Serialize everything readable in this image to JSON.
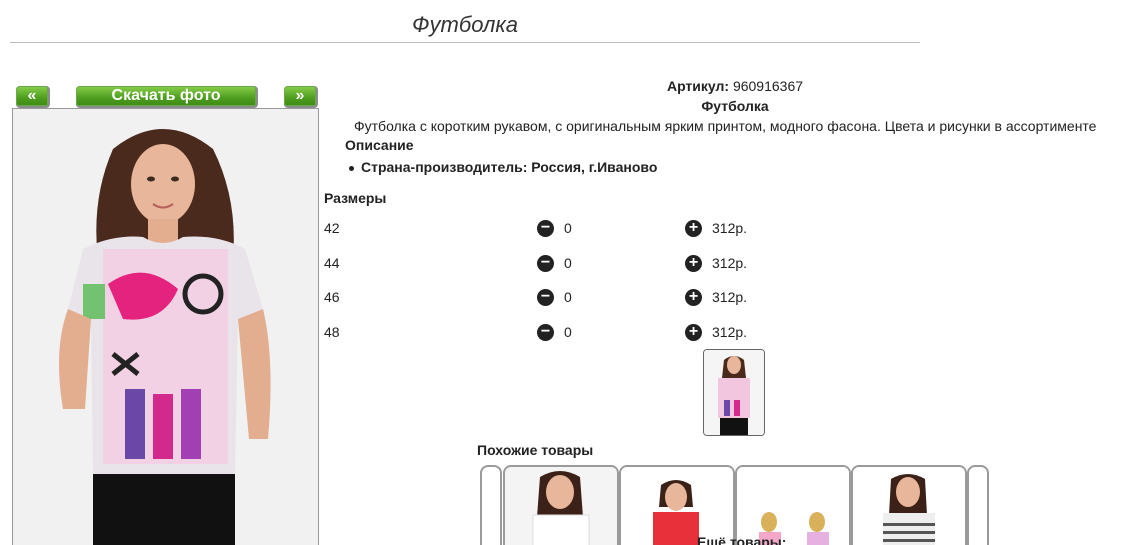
{
  "product": {
    "title": "Футболка",
    "article_label": "Артикул:",
    "article_value": "960916367",
    "name": "Футболка",
    "description": "Футболка с коротким рукавом, с оригинальным ярким принтом, модного фасона. Цвета и рисунки в ассортименте",
    "description_heading": "Описание",
    "country": "Страна-производитель: Россия, г.Иваново"
  },
  "gallery": {
    "prev_label": "«",
    "next_label": "»",
    "download_label": "Скачать фото"
  },
  "sizes": {
    "heading": "Размеры",
    "rows": [
      {
        "size": "42",
        "qty": "0",
        "price": "312р."
      },
      {
        "size": "44",
        "qty": "0",
        "price": "312р."
      },
      {
        "size": "46",
        "qty": "0",
        "price": "312р."
      },
      {
        "size": "48",
        "qty": "0",
        "price": "312р."
      }
    ]
  },
  "similar": {
    "heading": "Похожие товары",
    "more_heading": "Ещё товары:"
  },
  "colors": {
    "button_green": "#4e9d1f",
    "frame_gray": "#9a9a9a"
  }
}
